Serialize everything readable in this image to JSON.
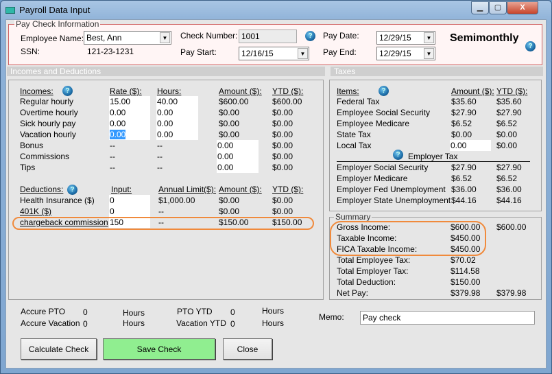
{
  "window": {
    "title": "Payroll Data Input",
    "minimize": "▁",
    "maximize": "▢",
    "close": "X"
  },
  "paycheck": {
    "legend": "Pay Check Information",
    "employee_label": "Employee Name:",
    "employee_value": "Best, Ann",
    "ssn_label": "SSN:",
    "ssn_value": "121-23-1231",
    "check_number_label": "Check Number:",
    "check_number_value": "1001",
    "pay_start_label": "Pay Start:",
    "pay_start_value": "12/16/15",
    "pay_date_label": "Pay Date:",
    "pay_date_value": "12/29/15",
    "pay_end_label": "Pay End:",
    "pay_end_value": "12/29/15",
    "frequency": "Semimonthly"
  },
  "bands": {
    "left": "Incomes and Deductions",
    "right": "Taxes"
  },
  "incomes": {
    "headers": [
      "Incomes:",
      "Rate ($):",
      "Hours:",
      "Amount ($):",
      "YTD ($):"
    ],
    "rows": [
      {
        "label": "Regular hourly",
        "rate": "15.00",
        "hours": "40.00",
        "amount": "$600.00",
        "ytd": "$600.00",
        "editable": "rate_hours"
      },
      {
        "label": "Overtime hourly",
        "rate": "0.00",
        "hours": "0.00",
        "amount": "$0.00",
        "ytd": "$0.00",
        "editable": "rate_hours"
      },
      {
        "label": "Sick hourly pay",
        "rate": "0.00",
        "hours": "0.00",
        "amount": "$0.00",
        "ytd": "$0.00",
        "editable": "rate_hours"
      },
      {
        "label": "Vacation hourly",
        "rate": "0.00",
        "hours": "0.00",
        "amount": "$0.00",
        "ytd": "$0.00",
        "editable": "rate_hours",
        "selected": true
      },
      {
        "label": "Bonus",
        "rate": "--",
        "hours": "--",
        "amount": "0.00",
        "ytd": "$0.00",
        "editable": "amount"
      },
      {
        "label": "Commissions",
        "rate": "--",
        "hours": "--",
        "amount": "0.00",
        "ytd": "$0.00",
        "editable": "amount"
      },
      {
        "label": "Tips",
        "rate": "--",
        "hours": "--",
        "amount": "0.00",
        "ytd": "$0.00",
        "editable": "amount"
      }
    ]
  },
  "deductions": {
    "headers": [
      "Deductions:",
      "Input:",
      "Annual Limit($):",
      "Amount ($):",
      "YTD ($):"
    ],
    "rows": [
      {
        "label": "Health Insurance  ($)",
        "input": "0",
        "limit": "$1,000.00",
        "amount": "$0.00",
        "ytd": "$0.00",
        "link": false
      },
      {
        "label": "401K  ($)",
        "input": "0",
        "limit": "--",
        "amount": "$0.00",
        "ytd": "$0.00",
        "link": true
      },
      {
        "label": "chargeback commission",
        "input": "150",
        "limit": "--",
        "amount": "$150.00",
        "ytd": "$150.00",
        "link": true,
        "highlighted": true
      }
    ]
  },
  "taxes": {
    "headers": [
      "Items:",
      "Amount ($):",
      "YTD ($):"
    ],
    "employee_rows": [
      {
        "label": "Federal Tax",
        "amount": "$35.60",
        "ytd": "$35.60"
      },
      {
        "label": "Employee Social Security",
        "amount": "$27.90",
        "ytd": "$27.90"
      },
      {
        "label": "Employee Medicare",
        "amount": "$6.52",
        "ytd": "$6.52"
      },
      {
        "label": "State Tax",
        "amount": "$0.00",
        "ytd": "$0.00"
      },
      {
        "label": "Local Tax",
        "amount": "0.00",
        "ytd": "$0.00",
        "editable": true
      }
    ],
    "employer_title": "Employer Tax",
    "employer_rows": [
      {
        "label": "Employer Social Security",
        "amount": "$27.90",
        "ytd": "$27.90"
      },
      {
        "label": "Employer Medicare",
        "amount": "$6.52",
        "ytd": "$6.52"
      },
      {
        "label": "Employer Fed Unemployment",
        "amount": "$36.00",
        "ytd": "$36.00"
      },
      {
        "label": "Employer State Unemployment",
        "amount": "$44.16",
        "ytd": "$44.16"
      }
    ]
  },
  "summary": {
    "legend": "Summary",
    "rows": [
      {
        "label": "Gross Income:",
        "amount": "$600.00",
        "ytd": "$600.00"
      },
      {
        "label": "Taxable Income:",
        "amount": "$450.00",
        "ytd": ""
      },
      {
        "label": "FICA Taxable Income:",
        "amount": "$450.00",
        "ytd": ""
      },
      {
        "label": "Total Employee Tax:",
        "amount": "$70.02",
        "ytd": ""
      },
      {
        "label": "Total Employer Tax:",
        "amount": "$114.58",
        "ytd": ""
      },
      {
        "label": "Total Deduction:",
        "amount": "$150.00",
        "ytd": ""
      },
      {
        "label": "Net Pay:",
        "amount": "$379.98",
        "ytd": "$379.98"
      }
    ]
  },
  "pto": {
    "accure_pto_label": "Accure PTO",
    "accure_pto_value": "0",
    "accure_vacation_label": "Accure Vacation",
    "accure_vacation_value": "0",
    "hours": "Hours",
    "pto_ytd_label": "PTO YTD",
    "pto_ytd_value": "0",
    "vacation_ytd_label": "Vacation YTD",
    "vacation_ytd_value": "0"
  },
  "memo": {
    "label": "Memo:",
    "value": "Pay check"
  },
  "buttons": {
    "calculate": "Calculate Check",
    "save": "Save Check",
    "close": "Close"
  },
  "colors": {
    "save_button": "#90ee90",
    "highlight_oval": "#f08a3c",
    "paycheck_border": "#d06060",
    "paycheck_bg": "#fff5f5"
  },
  "icons": {
    "help": "?",
    "dropdown": "▼"
  }
}
